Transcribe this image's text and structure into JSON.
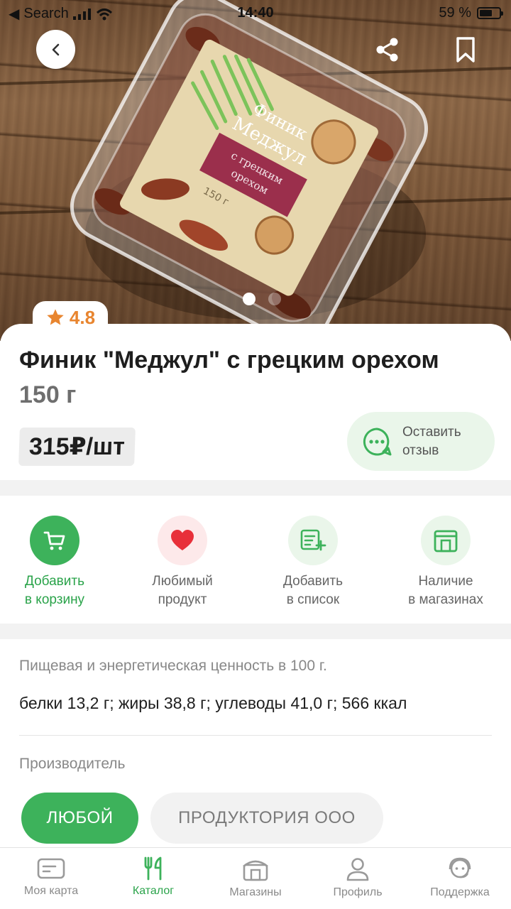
{
  "status_bar": {
    "carrier": "Search",
    "time": "14:40",
    "battery": "59 %"
  },
  "product": {
    "rating": "4.8",
    "title": "Финик \"Меджул\" с грецким орехом",
    "weight": "150 г",
    "price": "315₽/шт",
    "review_button": "Оставить отзыв",
    "package_text": {
      "brand_line_1": "Финик",
      "brand_line_2": "Меджул",
      "flavor": "с грецким орехом",
      "weight": "150 г"
    }
  },
  "gallery": {
    "total": 2,
    "active": 1
  },
  "actions": [
    {
      "label_1": "Добавить",
      "label_2": "в корзину",
      "icon": "cart-icon"
    },
    {
      "label_1": "Любимый",
      "label_2": "продукт",
      "icon": "heart-icon"
    },
    {
      "label_1": "Добавить",
      "label_2": "в список",
      "icon": "list-add-icon"
    },
    {
      "label_1": "Наличие",
      "label_2": "в магазинах",
      "icon": "store-icon"
    }
  ],
  "nutrition": {
    "title": "Пищевая и энергетическая ценность в 100 г.",
    "value": "белки 13,2 г; жиры 38,8 г; углеводы 41,0 г; 566 ккал"
  },
  "manufacturer": {
    "title": "Производитель",
    "options": [
      "ЛЮБОЙ",
      "ПРОДУКТОРИЯ ООО"
    ],
    "selected": "ЛЮБОЙ"
  },
  "tabbar": [
    {
      "label": "Моя карта",
      "icon": "card-icon"
    },
    {
      "label": "Каталог",
      "icon": "catalog-icon"
    },
    {
      "label": "Магазины",
      "icon": "shop-icon"
    },
    {
      "label": "Профиль",
      "icon": "profile-icon"
    },
    {
      "label": "Поддержка",
      "icon": "support-icon"
    }
  ],
  "active_tab": "Каталог",
  "colors": {
    "accent_green": "#3db25b",
    "accent_green_text": "#2aa34a",
    "rating_star": "#e8852f",
    "heart_red": "#e8303a",
    "light_green_bg": "#eaf6ea"
  }
}
